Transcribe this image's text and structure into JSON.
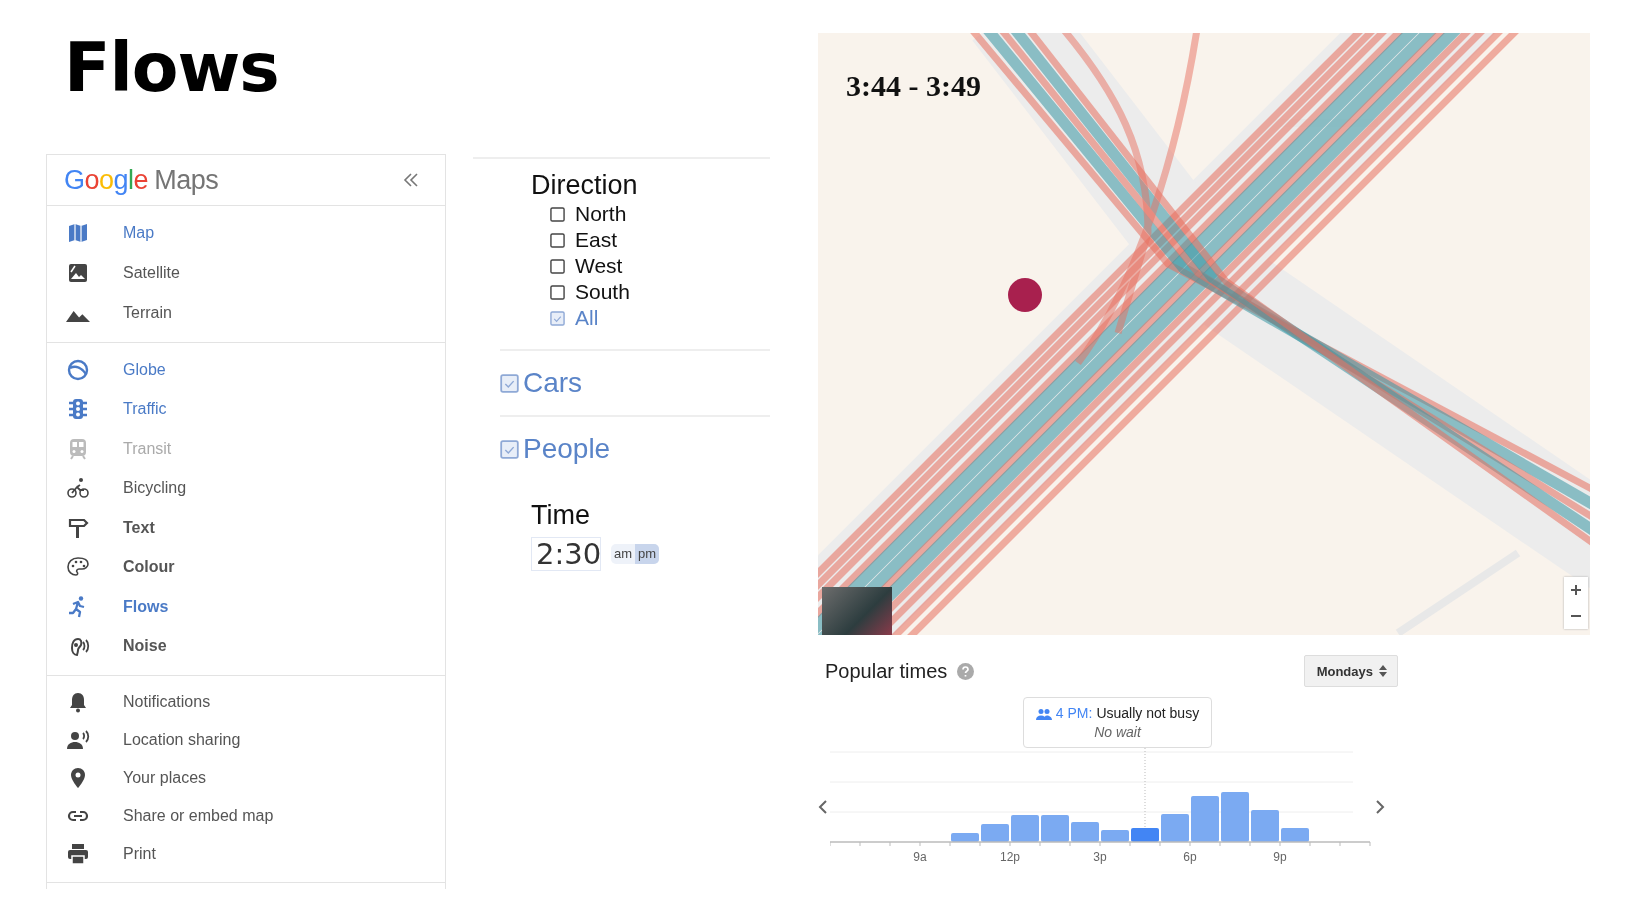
{
  "slide_title": "Flows",
  "sidebar": {
    "logo": {
      "brand": "Google",
      "product": "Maps"
    },
    "sections": [
      {
        "items": [
          {
            "label": "Map",
            "selected": true,
            "disabled": false,
            "emphasis": false
          },
          {
            "label": "Satellite",
            "selected": false,
            "disabled": false,
            "emphasis": false
          },
          {
            "label": "Terrain",
            "selected": false,
            "disabled": false,
            "emphasis": false
          }
        ]
      },
      {
        "items": [
          {
            "label": "Globe",
            "selected": true,
            "disabled": false,
            "emphasis": false
          },
          {
            "label": "Traffic",
            "selected": true,
            "disabled": false,
            "emphasis": false
          },
          {
            "label": "Transit",
            "selected": false,
            "disabled": true,
            "emphasis": false
          },
          {
            "label": "Bicycling",
            "selected": false,
            "disabled": false,
            "emphasis": false
          },
          {
            "label": "Text",
            "selected": false,
            "disabled": false,
            "emphasis": true
          },
          {
            "label": "Colour",
            "selected": false,
            "disabled": false,
            "emphasis": true
          },
          {
            "label": "Flows",
            "selected": true,
            "disabled": false,
            "emphasis": true
          },
          {
            "label": "Noise",
            "selected": false,
            "disabled": false,
            "emphasis": true
          }
        ]
      },
      {
        "items": [
          {
            "label": "Notifications",
            "selected": false,
            "disabled": false,
            "emphasis": false
          },
          {
            "label": "Location sharing",
            "selected": false,
            "disabled": false,
            "emphasis": false
          },
          {
            "label": "Your places",
            "selected": false,
            "disabled": false,
            "emphasis": false
          },
          {
            "label": "Share or embed map",
            "selected": false,
            "disabled": false,
            "emphasis": false
          },
          {
            "label": "Print",
            "selected": false,
            "disabled": false,
            "emphasis": false
          }
        ]
      }
    ]
  },
  "filters": {
    "direction": {
      "title": "Direction",
      "options": [
        {
          "label": "North",
          "checked": false
        },
        {
          "label": "East",
          "checked": false
        },
        {
          "label": "West",
          "checked": false
        },
        {
          "label": "South",
          "checked": false
        },
        {
          "label": "All",
          "checked": true
        }
      ]
    },
    "toggles": [
      {
        "label": "Cars",
        "checked": true
      },
      {
        "label": "People",
        "checked": true
      }
    ],
    "time": {
      "title": "Time",
      "value": "2:30",
      "periods": [
        {
          "label": "am",
          "selected": false
        },
        {
          "label": "pm",
          "selected": true
        }
      ]
    }
  },
  "map": {
    "time_range": "3:44 - 3:49"
  },
  "popular_times": {
    "title": "Popular times",
    "day_select": "Mondays",
    "tooltip": {
      "time": "4 PM:",
      "status": "Usually not busy",
      "wait": "No wait"
    },
    "x_labels": [
      "9a",
      "12p",
      "3p",
      "6p",
      "9p"
    ]
  }
}
